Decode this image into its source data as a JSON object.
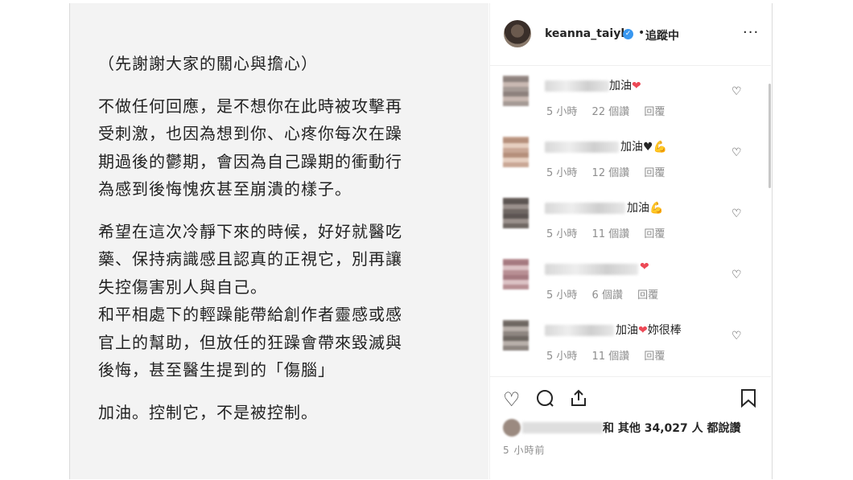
{
  "post": {
    "lines": [
      "（先謝謝大家的關心與擔心）",
      "不做任何回應，是不想你在此時被攻擊再",
      "受刺激，也因為想到你、心疼你每次在躁",
      "期過後的鬱期，會因為自己躁期的衝動行",
      "為感到後悔愧疚甚至崩潰的樣子。",
      "希望在這次冷靜下來的時候，好好就醫吃",
      "藥、保持病識感且認真的正視它，別再讓",
      "失控傷害別人與自己。",
      "和平相處下的輕躁能帶給創作者靈感或感",
      "官上的幫助，但放任的狂躁會帶來毀滅與",
      "後悔，甚至醫生提到的「傷腦」",
      "加油。控制它，不是被控制。"
    ]
  },
  "header": {
    "username": "keanna_taiyh",
    "verified_icon": "verified-badge-icon",
    "separator": "•",
    "follow_label": "追蹤中",
    "more_label": "···"
  },
  "comments": [
    {
      "text": "加油",
      "emoji": "❤",
      "emoji_type": "heart",
      "time": "5 小時",
      "likes": "22 個讚",
      "reply": "回覆"
    },
    {
      "text": "加油♥",
      "emoji": "💪",
      "emoji_type": "muscle",
      "time": "5 小時",
      "likes": "12 個讚",
      "reply": "回覆"
    },
    {
      "text": "加油",
      "emoji": "💪",
      "emoji_type": "muscle",
      "time": "5 小時",
      "likes": "11 個讚",
      "reply": "回覆"
    },
    {
      "text": "",
      "emoji": "❤",
      "emoji_type": "heart",
      "time": "5 小時",
      "likes": "6 個讚",
      "reply": "回覆"
    },
    {
      "text": "加油",
      "emoji": "❤",
      "emoji_type": "heart",
      "suffix": "妳很棒",
      "time": "5 小時",
      "likes": "11 個讚",
      "reply": "回覆"
    }
  ],
  "actions": {
    "likes_text": "和 其他 34,027 人 都說讚",
    "timestamp": "5 小時前",
    "icons": [
      "heart-icon",
      "comment-icon",
      "share-icon",
      "bookmark-icon"
    ]
  },
  "colors": {
    "heart": "#ed4956",
    "muscle": "#e8a33c",
    "verified": "#3897f0",
    "meta_gray": "#8e8e8e"
  }
}
